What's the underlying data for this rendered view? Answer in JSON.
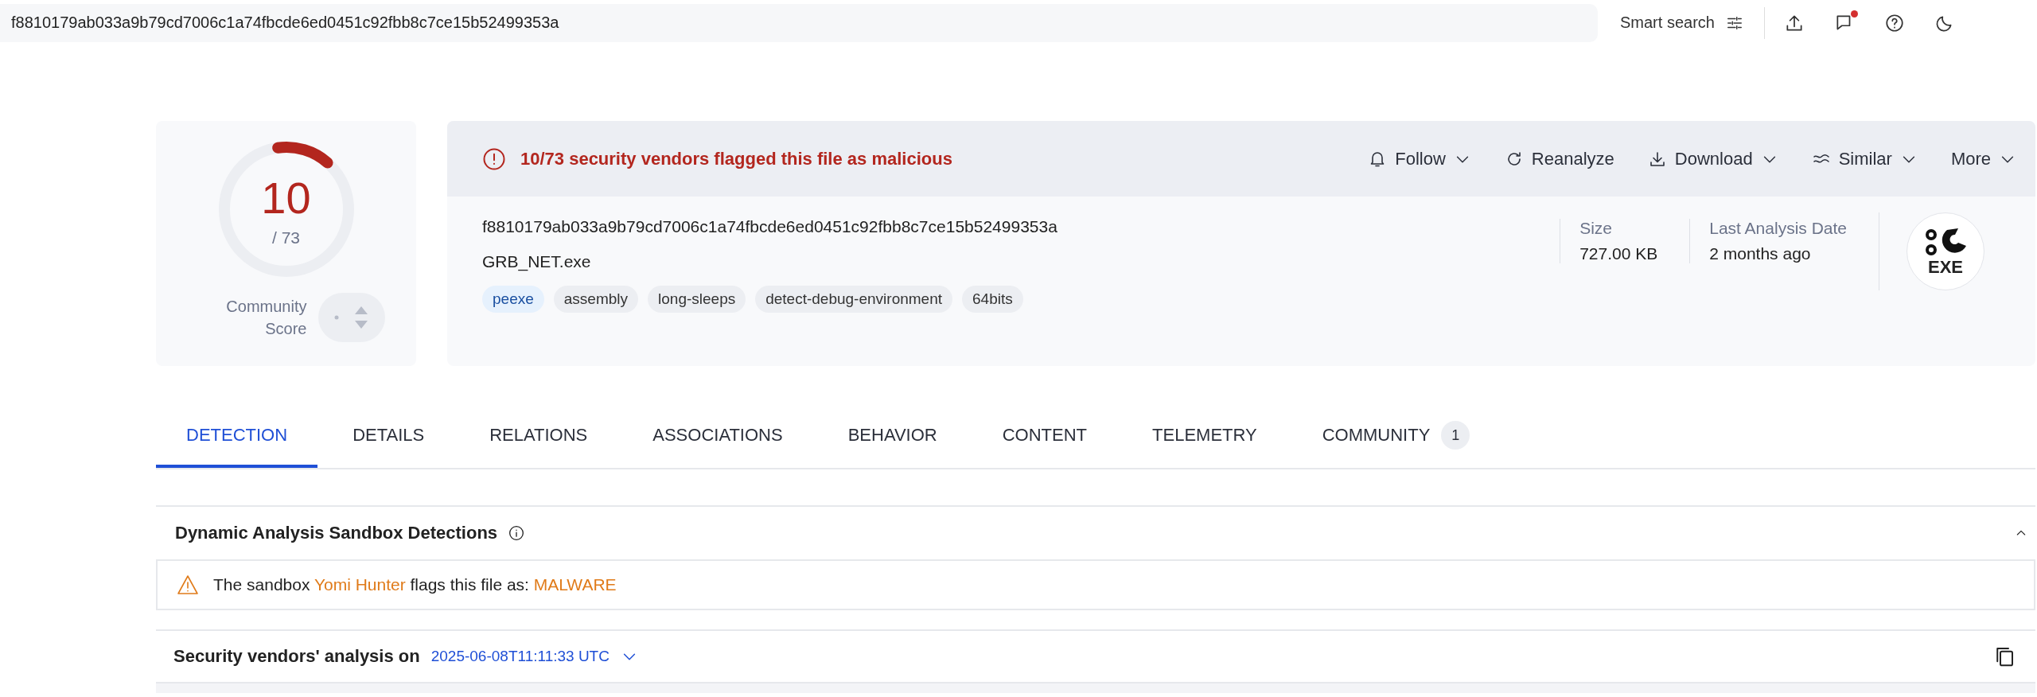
{
  "search": {
    "value": "f8810179ab033a9b79cd7006c1a74fbcde6ed0451c92fbb8c7ce15b52499353a",
    "smart_search": "Smart search",
    "notification_dot": true
  },
  "score": {
    "detections": "10",
    "total": "/ 73",
    "level": 0.137,
    "community_label": "Community Score"
  },
  "file": {
    "alert": "10/73 security vendors flagged this file as malicious",
    "actions": [
      {
        "label": "Follow",
        "dropdown": true
      },
      {
        "label": "Reanalyze",
        "dropdown": false
      },
      {
        "label": "Download",
        "dropdown": true
      },
      {
        "label": "Similar",
        "dropdown": true
      },
      {
        "label": "More",
        "dropdown": true
      }
    ],
    "hash": "f8810179ab033a9b79cd7006c1a74fbcde6ed0451c92fbb8c7ce15b52499353a",
    "name": "GRB_NET.exe",
    "tags": [
      {
        "label": "peexe",
        "kind": "filetype"
      },
      {
        "label": "assembly",
        "kind": "tag"
      },
      {
        "label": "long-sleeps",
        "kind": "tag"
      },
      {
        "label": "detect-debug-environment",
        "kind": "tag"
      },
      {
        "label": "64bits",
        "kind": "tag"
      }
    ],
    "stats": [
      {
        "label": "Size",
        "value": "727.00 KB"
      },
      {
        "label": "Last Analysis Date",
        "value": "2 months ago"
      }
    ],
    "type_badge": "EXE"
  },
  "tabs": [
    {
      "label": "DETECTION",
      "selected": true
    },
    {
      "label": "DETAILS",
      "selected": false
    },
    {
      "label": "RELATIONS",
      "selected": false
    },
    {
      "label": "ASSOCIATIONS",
      "selected": false
    },
    {
      "label": "BEHAVIOR",
      "selected": false
    },
    {
      "label": "CONTENT",
      "selected": false
    },
    {
      "label": "TELEMETRY",
      "selected": false
    },
    {
      "label": "COMMUNITY",
      "selected": false,
      "badge": "1"
    }
  ],
  "sandbox_section": {
    "title": "Dynamic Analysis Sandbox Detections",
    "expanded": true,
    "message": {
      "prefix": "The sandbox",
      "sandbox": "Yomi Hunter",
      "middle": "flags this file as:",
      "verdict": "MALWARE"
    }
  },
  "vendors_section": {
    "title": "Security vendors' analysis on",
    "date": "2025-06-08T11:11:33 UTC"
  }
}
